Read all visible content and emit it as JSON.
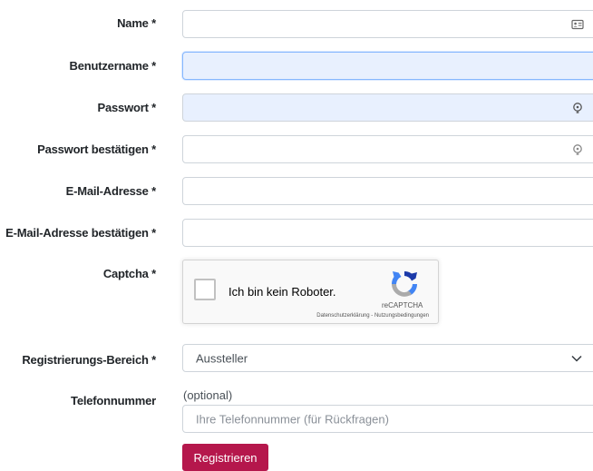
{
  "form": {
    "name_label": "Name *",
    "username_label": "Benutzername *",
    "password_label": "Passwort *",
    "password_confirm_label": "Passwort bestätigen *",
    "email_label": "E-Mail-Adresse *",
    "email_confirm_label": "E-Mail-Adresse bestätigen *",
    "captcha_label": "Captcha *",
    "area_label": "Registrierungs-Bereich *",
    "area_selected": "Aussteller",
    "phone_label": "Telefonnummer",
    "phone_optional": "(optional)",
    "phone_placeholder": "Ihre Telefonnummer (für Rückfragen)",
    "submit_label": "Registrieren"
  },
  "recaptcha": {
    "checkbox_text": "Ich bin kein Roboter.",
    "brand": "reCAPTCHA",
    "terms": "Datenschutzerklärung - Nutzungsbedingungen"
  },
  "colors": {
    "autofill_bg": "#e8f0fe",
    "submit_bg": "#b5174c"
  }
}
